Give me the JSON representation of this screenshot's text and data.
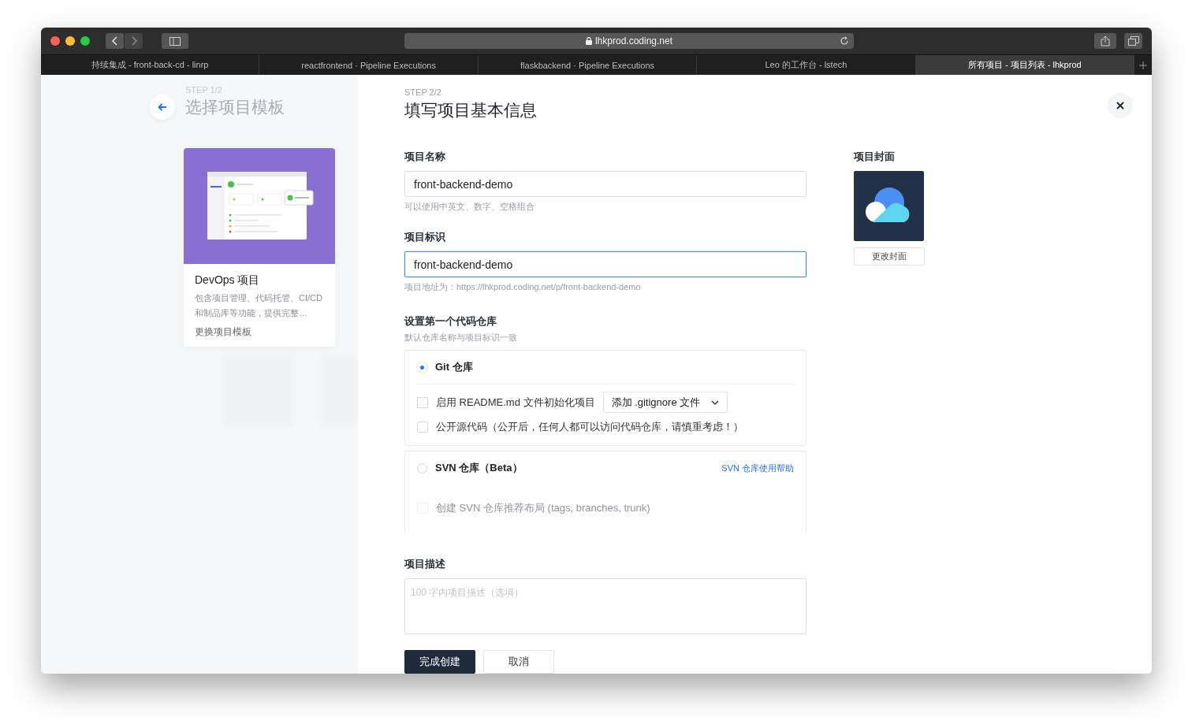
{
  "browser": {
    "url": "lhkprod.coding.net",
    "tabs": [
      {
        "label": "持续集成 - front-back-cd - linrp",
        "selected": false
      },
      {
        "label": "reactfrontend · Pipeline Executions",
        "selected": false
      },
      {
        "label": "flaskbackend · Pipeline Executions",
        "selected": false
      },
      {
        "label": "Leo 的工作台 - lstech",
        "selected": false
      },
      {
        "label": "所有项目 - 项目列表 - lhkprod",
        "selected": true
      }
    ]
  },
  "left_panel": {
    "step": "STEP 1/2",
    "title": "选择项目模板",
    "template": {
      "name": "DevOps 项目",
      "description": "包含项目管理、代码托管、CI/CD 和制品库等功能，提供完整…",
      "link": "更换项目模板"
    }
  },
  "form": {
    "step": "STEP 2/2",
    "title": "填写项目基本信息",
    "fields": [
      {
        "label": "项目名称",
        "value": "front-backend-demo",
        "hint": "可以使用中英文、数字、空格组合",
        "focused": false
      },
      {
        "label": "项目标识",
        "value": "front-backend-demo",
        "hint": "项目地址为：https://lhkprod.coding.net/p/front-backend-demo",
        "focused": true
      }
    ],
    "repo": {
      "label": "设置第一个代码仓库",
      "hint": "默认仓库名称与项目标识一致",
      "options": [
        {
          "label": "Git 仓库",
          "selected": true,
          "settings": [
            {
              "label": "启用 README.md 文件初始化项目",
              "checked": false,
              "disabled": false,
              "dropdown": "添加 .gitignore 文件"
            },
            {
              "label": "公开源代码（公开后，任何人都可以访问代码仓库，请慎重考虑！）",
              "checked": false,
              "disabled": false
            }
          ]
        },
        {
          "label": "SVN 仓库（Beta）",
          "selected": false,
          "help_link": "SVN 仓库使用帮助",
          "settings": [
            {
              "label": "创建 SVN 仓库推荐布局 (tags, branches, trunk)",
              "checked": false,
              "disabled": true
            }
          ]
        }
      ]
    },
    "description": {
      "label": "项目描述",
      "placeholder": "100 字内项目描述（选填）"
    },
    "buttons": [
      {
        "label": "完成创建",
        "kind": "primary"
      },
      {
        "label": "取消",
        "kind": "secondary"
      }
    ]
  },
  "cover": {
    "label": "项目封面",
    "button": "更改封面"
  }
}
